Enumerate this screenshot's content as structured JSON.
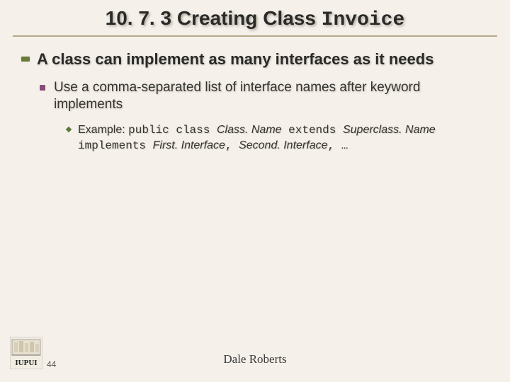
{
  "title": {
    "prefix": "10. 7. 3 Creating Class ",
    "mono": "Invoice"
  },
  "bullets": {
    "lvl1": "A class can implement as many interfaces as it needs",
    "lvl2": "Use a comma-separated list of interface names after keyword implements",
    "lvl3": {
      "lead": "Example: ",
      "code1": "public class ",
      "ital1": "Class. Name",
      "code2": " extends ",
      "ital2": "Superclass. Name",
      "code3": " implements ",
      "ital3": "First. Interface",
      "comma1": ", ",
      "ital4": "Second. Interface",
      "tail": ", …"
    }
  },
  "footer": {
    "page": "44",
    "author": "Dale Roberts",
    "logo_alt": "IUPUI"
  }
}
